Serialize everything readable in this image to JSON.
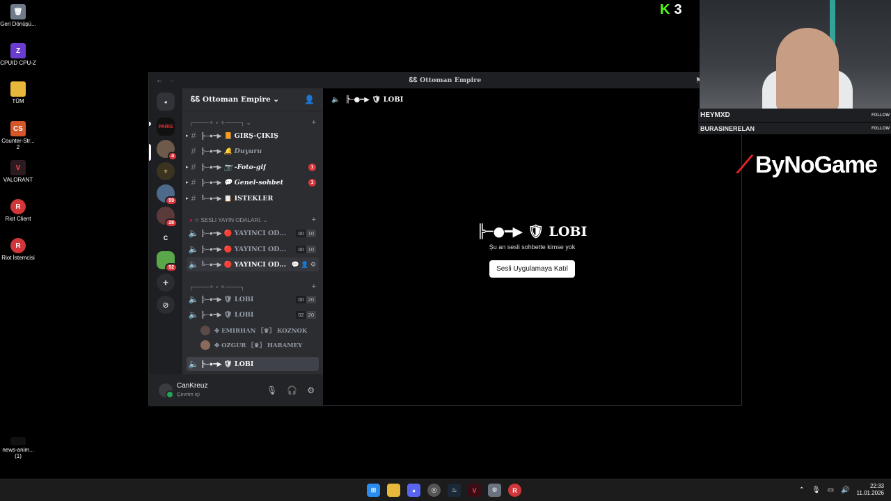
{
  "desktop": {
    "icons": [
      {
        "label": "Geri Dönüşü...",
        "icon": "recycle-bin-icon"
      },
      {
        "label": "CPUID CPU-Z",
        "icon": "cpuz-icon"
      },
      {
        "label": "TÜM",
        "icon": "folder-icon"
      },
      {
        "label": "Counter-Str... 2",
        "icon": "cs2-icon"
      },
      {
        "label": "VALORANT",
        "icon": "valorant-icon"
      },
      {
        "label": "Riot Client",
        "icon": "riot-client-icon"
      },
      {
        "label": "Riot İstemcisi",
        "icon": "riot-client-icon"
      },
      {
        "label": "news-anim... (1)",
        "icon": "file-icon"
      }
    ]
  },
  "discord": {
    "window_title": "ᏋᏋ Ottoman Empire",
    "server_name": "ᏋᏋ Ottoman Empire",
    "rail": {
      "servers": [
        {
          "label": "PARIS",
          "badge": ""
        },
        {
          "label": "",
          "badge": "4"
        },
        {
          "label": "",
          "badge": ""
        },
        {
          "label": "",
          "badge": "59"
        },
        {
          "label": "",
          "badge": "28"
        },
        {
          "label": "C",
          "badge": ""
        },
        {
          "label": "",
          "badge": "52"
        }
      ]
    },
    "categories": {
      "top": "┌────✧ ⋆ ✧────┐",
      "voice_stream": "☆ SESLI YAYIN ODALARI.",
      "lobby": "┌────✧ ⋆ ✧────┐"
    },
    "text_channels": [
      {
        "deco": "╠─●━▶",
        "name": "📙 GIRŞ-ÇIKIŞ",
        "unread": ""
      },
      {
        "deco": "╠─●━▶",
        "name": "🔔 Duyuru",
        "unread": ""
      },
      {
        "deco": "╠─●━▶",
        "name": "📷 -Foto-gif",
        "unread": "1"
      },
      {
        "deco": "╠─●━▶",
        "name": "💬 Genel-sohbet",
        "unread": "1"
      },
      {
        "deco": "╚─●━▶",
        "name": "📋 ISTEKLER",
        "unread": ""
      }
    ],
    "stream_channels": [
      {
        "deco": "╠─●━▶",
        "name": "🔴 YAYINCI OD...",
        "count": "00",
        "limit": "10"
      },
      {
        "deco": "╠─●━▶",
        "name": "🔴 YAYINCI OD...",
        "count": "00",
        "limit": "10"
      },
      {
        "deco": "╚─●━▶",
        "name": "🔴 YAYINCI OD...",
        "count": "",
        "limit": ""
      }
    ],
    "lobby_channels": [
      {
        "deco": "╠─●━▶",
        "name": "🛡 LOBI",
        "count": "00",
        "limit": "20"
      },
      {
        "deco": "╠─●━▶",
        "name": "🛡 LOBI",
        "count": "02",
        "limit": "20"
      },
      {
        "deco": "╠─●━▶",
        "name": "🛡 LOBI",
        "count": "",
        "limit": ""
      }
    ],
    "members": [
      "✤ EMIRHAN 〖♛〗 KOZNOK",
      "✤ OZGUR 〖♛〗 HARAMEY"
    ],
    "user": {
      "name": "CanKreuz",
      "status": "Çevrim içi"
    },
    "main": {
      "header": "╠─●━▶ 🛡 LOBI",
      "title": "╠─●━▶ 🛡 LOBI",
      "subtitle": "Şu an sesli sohbette kimse yok",
      "join_button": "Sesli Uygulamaya Katıl"
    }
  },
  "overlay": {
    "kick_count": "3",
    "cam_name": "HEYMXD",
    "cam_sub": "BURASINERELAN",
    "follow_label": "FOLLOW",
    "sponsor": "ByNoGame"
  },
  "taskbar": {
    "time": "22:33",
    "date": "11.01.2026",
    "apps": [
      "windows",
      "explorer",
      "discord",
      "chrome",
      "steam",
      "valorant",
      "settings",
      "riot"
    ]
  }
}
